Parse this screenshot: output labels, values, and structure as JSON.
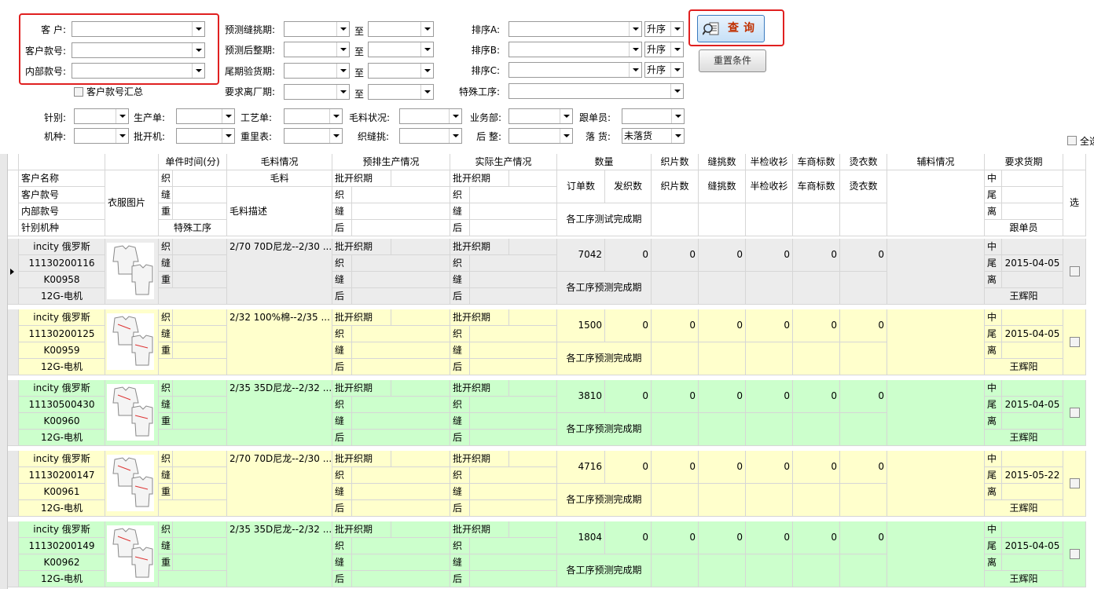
{
  "filters": {
    "customer_label": "客  户:",
    "customer_style_label": "客户款号:",
    "internal_style_label": "内部款号:",
    "customer_style_summary": "客户款号汇总",
    "pred_seam_label": "预测缝挑期:",
    "pred_finish_label": "预测后整期:",
    "tail_inspect_label": "尾期验货期:",
    "req_leave_label": "要求离厂期:",
    "to_label": "至",
    "sort_a_label": "排序A:",
    "sort_b_label": "排序B:",
    "sort_c_label": "排序C:",
    "special_proc_label": "特殊工序:",
    "sort_order_a": "升序",
    "sort_order_b": "升序",
    "sort_order_c": "升序",
    "needle_label": "针别:",
    "prod_order_label": "生产单:",
    "craft_order_label": "工艺单:",
    "yarn_status_label": "毛料状况:",
    "business_dept_label": "业务部:",
    "follower_label": "跟单员:",
    "machine_label": "机种:",
    "cut_machine_label": "批开机:",
    "weight_table_label": "重里表:",
    "knit_seam_label": "织缝挑:",
    "post_finish_label": "后 整:",
    "drop_goods_label": "落  货:",
    "drop_goods_value": "未落货",
    "select_all": "全选",
    "query_button": "查询",
    "reset_button": "重置条件"
  },
  "header": {
    "unit_time": "单件时间(分)",
    "yarn_info": "毛料情况",
    "pre_prod": "预排生产情况",
    "actual_prod": "实际生产情况",
    "quantity": "数量",
    "knit_pieces": "织片数",
    "seam_count": "缝挑数",
    "half_inspect": "半检收衫",
    "label_count": "车商标数",
    "iron_count": "烫衣数",
    "accessory": "辅料情况",
    "req_delivery": "要求货期",
    "customer_name": "客户名称",
    "customer_style": "客户款号",
    "internal_style": "内部款号",
    "needle_machine": "针别机种",
    "garment_image": "衣服图片",
    "knit": "织",
    "seam": "缝",
    "weight": "重",
    "special_proc": "特殊工序",
    "yarn": "毛料",
    "yarn_desc": "毛料描述",
    "cut_knit": "批开织期",
    "knit2": "织",
    "seam2": "缝",
    "post": "后",
    "order_qty": "订单数",
    "sent_knit": "发织数",
    "proc_test": "各工序测试完成期",
    "mid": "中",
    "tail": "尾",
    "leave": "离",
    "follower": "跟单员",
    "select": "选"
  },
  "rows": [
    {
      "customer": "incity 俄罗斯",
      "cust_style": "11130200116",
      "internal": "K00958",
      "machine": "12G-电机",
      "yarn": "2/70 70D尼龙--2/30 ...",
      "order_qty": "7042",
      "knit": "0",
      "seam": "0",
      "half": "0",
      "label": "0",
      "iron": "0",
      "sent": "0",
      "pred": "各工序预测完成期",
      "date": "2015-04-05",
      "follower": "王辉阳",
      "bg": "#ececec"
    },
    {
      "customer": "incity 俄罗斯",
      "cust_style": "11130200125",
      "internal": "K00959",
      "machine": "12G-电机",
      "yarn": "2/32 100%棉--2/35 ...",
      "order_qty": "1500",
      "knit": "0",
      "seam": "0",
      "half": "0",
      "label": "0",
      "iron": "0",
      "sent": "0",
      "pred": "各工序预测完成期",
      "date": "2015-04-05",
      "follower": "王辉阳",
      "bg": "#ffffcc"
    },
    {
      "customer": "incity 俄罗斯",
      "cust_style": "11130500430",
      "internal": "K00960",
      "machine": "12G-电机",
      "yarn": "2/35 35D尼龙--2/32 ...",
      "order_qty": "3810",
      "knit": "0",
      "seam": "0",
      "half": "0",
      "label": "0",
      "iron": "0",
      "sent": "0",
      "pred": "各工序预测完成期",
      "date": "2015-04-05",
      "follower": "王辉阳",
      "bg": "#ccffcc"
    },
    {
      "customer": "incity 俄罗斯",
      "cust_style": "11130200147",
      "internal": "K00961",
      "machine": "12G-电机",
      "yarn": "2/70 70D尼龙--2/30 ...",
      "order_qty": "4716",
      "knit": "0",
      "seam": "0",
      "half": "0",
      "label": "0",
      "iron": "0",
      "sent": "0",
      "pred": "各工序预测完成期",
      "date": "2015-05-22",
      "follower": "王辉阳",
      "bg": "#ffffcc"
    },
    {
      "customer": "incity 俄罗斯",
      "cust_style": "11130200149",
      "internal": "K00962",
      "machine": "12G-电机",
      "yarn": "2/35 35D尼龙--2/32 ...",
      "order_qty": "1804",
      "knit": "0",
      "seam": "0",
      "half": "0",
      "label": "0",
      "iron": "0",
      "sent": "0",
      "pred": "各工序预测完成期",
      "date": "2015-04-05",
      "follower": "王辉阳",
      "bg": "#ccffcc"
    }
  ],
  "icons": {
    "query": "magnifier-doc-icon",
    "row_pointer": "row-pointer-icon"
  }
}
